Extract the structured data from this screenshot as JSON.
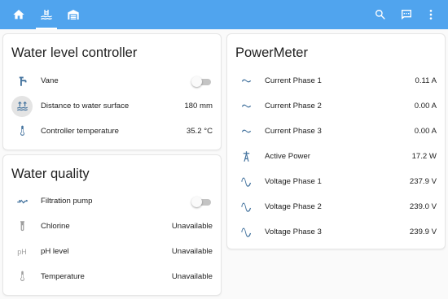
{
  "colors": {
    "header": "#50a4ee",
    "icon": "#44739e",
    "icon_disabled": "#9e9e9e"
  },
  "header": {
    "tabs": [
      {
        "icon": "home-icon"
      },
      {
        "icon": "pool-icon",
        "active": true
      },
      {
        "icon": "garage-icon"
      }
    ],
    "actions": [
      {
        "icon": "search-icon"
      },
      {
        "icon": "chat-icon"
      },
      {
        "icon": "more-vertical-icon"
      }
    ]
  },
  "water_level": {
    "title": "Water level controller",
    "rows": [
      {
        "icon": "valve-icon",
        "label": "Vane",
        "toggle": false
      },
      {
        "icon": "arrow-expand-up-icon",
        "label": "Distance to water surface",
        "value": "180 mm"
      },
      {
        "icon": "thermometer-icon",
        "label": "Controller temperature",
        "value": "35.2 °C"
      }
    ]
  },
  "water_quality": {
    "title": "Water quality",
    "rows": [
      {
        "icon": "pump-icon",
        "label": "Filtration pump",
        "toggle": false
      },
      {
        "icon": "test-tube-icon",
        "label": "Chlorine",
        "value": "Unavailable"
      },
      {
        "icon": "ph-icon",
        "ph_glyph": "pH",
        "label": "pH level",
        "value": "Unavailable"
      },
      {
        "icon": "thermometer-icon",
        "label": "Temperature",
        "value": "Unavailable"
      }
    ]
  },
  "power_meter": {
    "title": "PowerMeter",
    "rows": [
      {
        "icon": "current-ac-icon",
        "label": "Current Phase 1",
        "value": "0.11 A"
      },
      {
        "icon": "current-ac-icon",
        "label": "Current Phase 2",
        "value": "0.00 A"
      },
      {
        "icon": "current-ac-icon",
        "label": "Current Phase 3",
        "value": "0.00 A"
      },
      {
        "icon": "transmission-tower-icon",
        "label": "Active Power",
        "value": "17.2 W"
      },
      {
        "icon": "sine-wave-icon",
        "label": "Voltage Phase 1",
        "value": "237.9 V"
      },
      {
        "icon": "sine-wave-icon",
        "label": "Voltage Phase 2",
        "value": "239.0 V"
      },
      {
        "icon": "sine-wave-icon",
        "label": "Voltage Phase 3",
        "value": "239.9 V"
      }
    ]
  }
}
